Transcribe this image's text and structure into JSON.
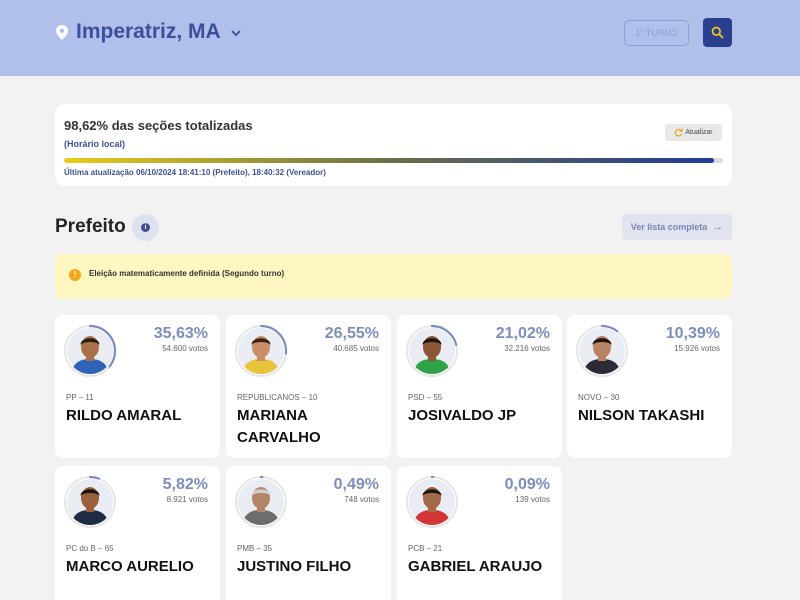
{
  "header": {
    "location": "Imperatriz, MA",
    "turno_label": "1º TURNO"
  },
  "status": {
    "percent_text": "98,62% das seções totalizadas",
    "local_time_note": "(Horário local)",
    "update_label": "Atualizar",
    "progress": 0.9862,
    "last_update": "Última atualização 06/10/2024 18:41:10 (Prefeito), 18:40:32 (Vereador)"
  },
  "section": {
    "title": "Prefeito",
    "info_glyph": "i",
    "full_list_label": "Ver lista completa"
  },
  "alert": {
    "icon_glyph": "!",
    "text": "Eleição matematicamente definida (Segundo turno)"
  },
  "candidates": [
    {
      "percent": "35,63%",
      "share": 0.3563,
      "votes": "54.600 votos",
      "party": "PP – 11",
      "name": "RILDO AMARAL",
      "skin": "#a9704a",
      "hair": "#2a1d14",
      "shirt": "#2f63b8"
    },
    {
      "percent": "26,55%",
      "share": 0.2655,
      "votes": "40.685 votos",
      "party": "REPUBLICANOS – 10",
      "name": "MARIANA CARVALHO",
      "skin": "#c98e68",
      "hair": "#3a2418",
      "shirt": "#e7c23a"
    },
    {
      "percent": "21,02%",
      "share": 0.2102,
      "votes": "32.216 votos",
      "party": "PSD – 55",
      "name": "JOSIVALDO JP",
      "skin": "#8a5636",
      "hair": "#1f140e",
      "shirt": "#2ea34a"
    },
    {
      "percent": "10,39%",
      "share": 0.1039,
      "votes": "15.926 votos",
      "party": "NOVO – 30",
      "name": "NILSON TAKASHI",
      "skin": "#b98262",
      "hair": "#1c1410",
      "shirt": "#2c2c36"
    },
    {
      "percent": "5,82%",
      "share": 0.0582,
      "votes": "8.921 votos",
      "party": "PC do B – 65",
      "name": "MARCO AURELIO",
      "skin": "#9a603e",
      "hair": "#1d140e",
      "shirt": "#1f2a44"
    },
    {
      "percent": "0,49%",
      "share": 0.0049,
      "votes": "748 votos",
      "party": "PMB – 35",
      "name": "JUSTINO FILHO",
      "skin": "#b58466",
      "hair": "#cfcfcf",
      "shirt": "#6d6d6d"
    },
    {
      "percent": "0,09%",
      "share": 0.0009,
      "votes": "139 votos",
      "party": "PCB – 21",
      "name": "GABRIEL ARAUJO",
      "skin": "#a36a48",
      "hair": "#201611",
      "shirt": "#d33535"
    }
  ],
  "colors": {
    "header_bg": "#b0c0ea",
    "accent": "#3d4f9c",
    "ring": "#7c8ec0",
    "alert_bg": "#fff7c2"
  },
  "icons": {
    "location": "location-pin-icon",
    "dropdown": "chevron-down-icon",
    "search": "search-icon",
    "refresh": "refresh-icon",
    "info": "info-icon",
    "arrow": "arrow-right-icon",
    "warning": "warning-icon"
  }
}
